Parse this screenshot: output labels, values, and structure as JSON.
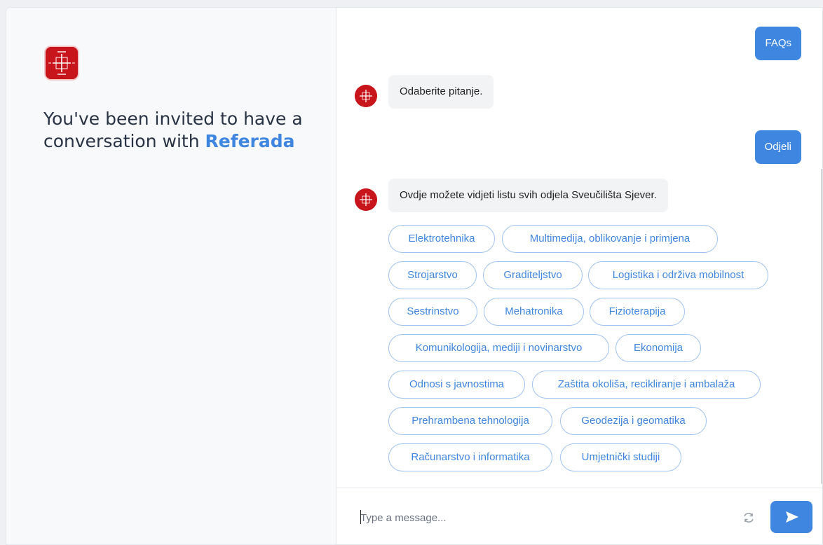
{
  "colors": {
    "accent": "#3f86e0",
    "brand_red": "#c8141b",
    "bot_bubble_bg": "#f2f3f5"
  },
  "sidebar": {
    "logo_icon": "university-logo-icon",
    "invite_text": "You've been invited to have a conversation with ",
    "bot_name": "Referada"
  },
  "chat": {
    "messages": [
      {
        "from": "user",
        "text": "FAQs"
      },
      {
        "from": "bot",
        "text": "Odaberite pitanje."
      },
      {
        "from": "user",
        "text": "Odjeli"
      },
      {
        "from": "bot",
        "text": "Ovdje možete vidjeti listu svih odjela Sveučilišta Sjever."
      }
    ],
    "quick_replies": [
      "Elektrotehnika",
      "Multimedija, oblikovanje i primjena",
      "Strojarstvo",
      "Graditeljstvo",
      "Logistika i održiva mobilnost",
      "Sestrinstvo",
      "Mehatronika",
      "Fizioterapija",
      "Komunikologija, mediji i novinarstvo",
      "Ekonomija",
      "Odnosi s javnostima",
      "Zaštita okoliša, recikliranje i ambalaža",
      "Prehrambena tehnologija",
      "Geodezija i geomatika",
      "Računarstvo i informatika",
      "Umjetnički studiji"
    ]
  },
  "composer": {
    "placeholder": "Type a message...",
    "value": "",
    "refresh_icon": "refresh-icon",
    "send_icon": "send-icon"
  }
}
